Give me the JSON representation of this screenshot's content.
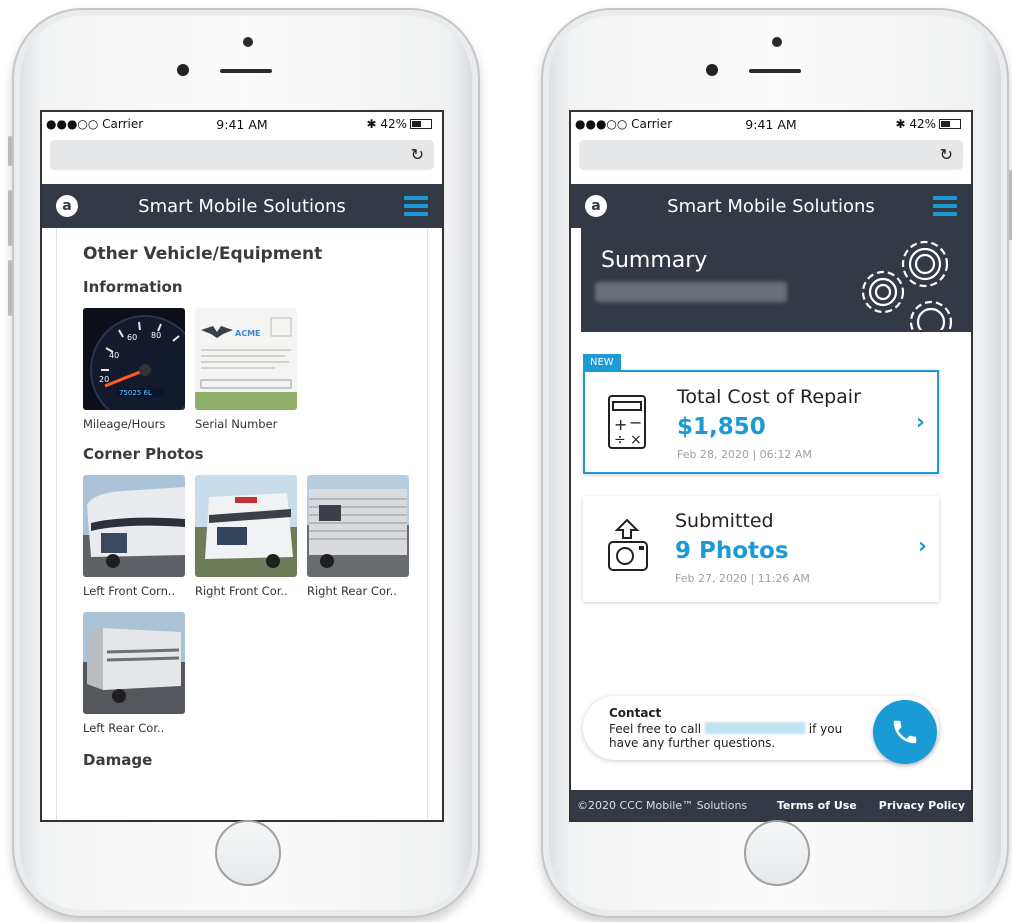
{
  "left_phone": {
    "status": {
      "carrier": "●●●○○ Carrier",
      "time": "9:41 AM",
      "battery": "42%"
    },
    "app_title": "Smart Mobile Solutions",
    "logo_letter": "a",
    "section_title": "Other Vehicle/Equipment",
    "info_heading": "Information",
    "info_items": [
      {
        "caption": "Mileage/Hours",
        "image": "speedometer-photo"
      },
      {
        "caption": "Serial Number",
        "image": "document-photo"
      }
    ],
    "document_brand": "ACME",
    "corner_heading": "Corner Photos",
    "corner_items": [
      {
        "caption": "Left Front Corn..",
        "image": "rv-photo"
      },
      {
        "caption": "Right Front Cor..",
        "image": "rv-photo"
      },
      {
        "caption": "Right Rear Cor..",
        "image": "rv-photo"
      },
      {
        "caption": "Left Rear Cor..",
        "image": "rv-photo"
      }
    ],
    "damage_heading": "Damage"
  },
  "right_phone": {
    "status": {
      "carrier": "●●●○○ Carrier",
      "time": "9:41 AM",
      "battery": "42%"
    },
    "app_title": "Smart Mobile Solutions",
    "logo_letter": "a",
    "summary_title": "Summary",
    "cards": [
      {
        "badge": "NEW",
        "label": "Total Cost of Repair",
        "value": "$1,850",
        "date": "Feb 28, 2020 | 06:12 AM",
        "icon": "calculator-icon"
      },
      {
        "label": "Submitted",
        "value": "9 Photos",
        "date": "Feb 27, 2020 | 11:26 AM",
        "icon": "camera-upload-icon"
      }
    ],
    "contact": {
      "title": "Contact",
      "line_start": "Feel free to call",
      "line_end": "if you have any further questions."
    },
    "footer": {
      "copyright": "©2020 CCC Mobile™ Solutions",
      "terms": "Terms of Use",
      "privacy": "Privacy Policy"
    }
  },
  "colors": {
    "accent": "#1a9bd6",
    "header_bg": "#333945"
  }
}
